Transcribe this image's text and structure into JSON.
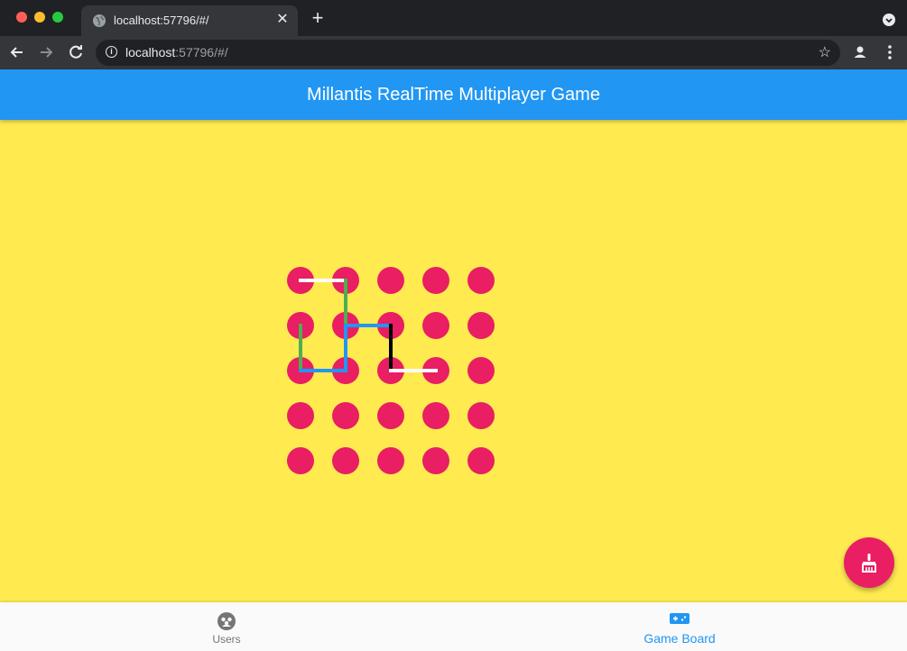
{
  "browser": {
    "tab_title": "localhost:57796/#/",
    "url_host": "localhost",
    "url_rest": ":57796/#/"
  },
  "app": {
    "title": "Millantis RealTime Multiplayer Game"
  },
  "board": {
    "rows": 5,
    "cols": 5,
    "dot_color": "#e91e63",
    "lines": [
      {
        "from": [
          0,
          0
        ],
        "to": [
          1,
          0
        ],
        "color": "#ffffff"
      },
      {
        "from": [
          1,
          0
        ],
        "to": [
          1,
          1
        ],
        "color": "#4caf50"
      },
      {
        "from": [
          0,
          1
        ],
        "to": [
          0,
          2
        ],
        "color": "#4caf50"
      },
      {
        "from": [
          0,
          2
        ],
        "to": [
          1,
          2
        ],
        "color": "#2196f3"
      },
      {
        "from": [
          1,
          1
        ],
        "to": [
          1,
          2
        ],
        "color": "#2196f3"
      },
      {
        "from": [
          1,
          1
        ],
        "to": [
          2,
          1
        ],
        "color": "#2196f3"
      },
      {
        "from": [
          2,
          1
        ],
        "to": [
          2,
          2
        ],
        "color": "#000000"
      },
      {
        "from": [
          2,
          2
        ],
        "to": [
          3,
          2
        ],
        "color": "#ffffff"
      }
    ]
  },
  "fab": {
    "icon": "cleaning-brush-icon"
  },
  "bottom_nav": {
    "items": [
      {
        "label": "Users",
        "icon": "group-icon",
        "active": false
      },
      {
        "label": "Game Board",
        "icon": "gamepad-icon",
        "active": true
      }
    ]
  },
  "colors": {
    "appbar": "#2196f3",
    "background": "#ffeb50",
    "accent": "#e91e63",
    "nav_active": "#2196f3",
    "nav_inactive": "#757575"
  }
}
